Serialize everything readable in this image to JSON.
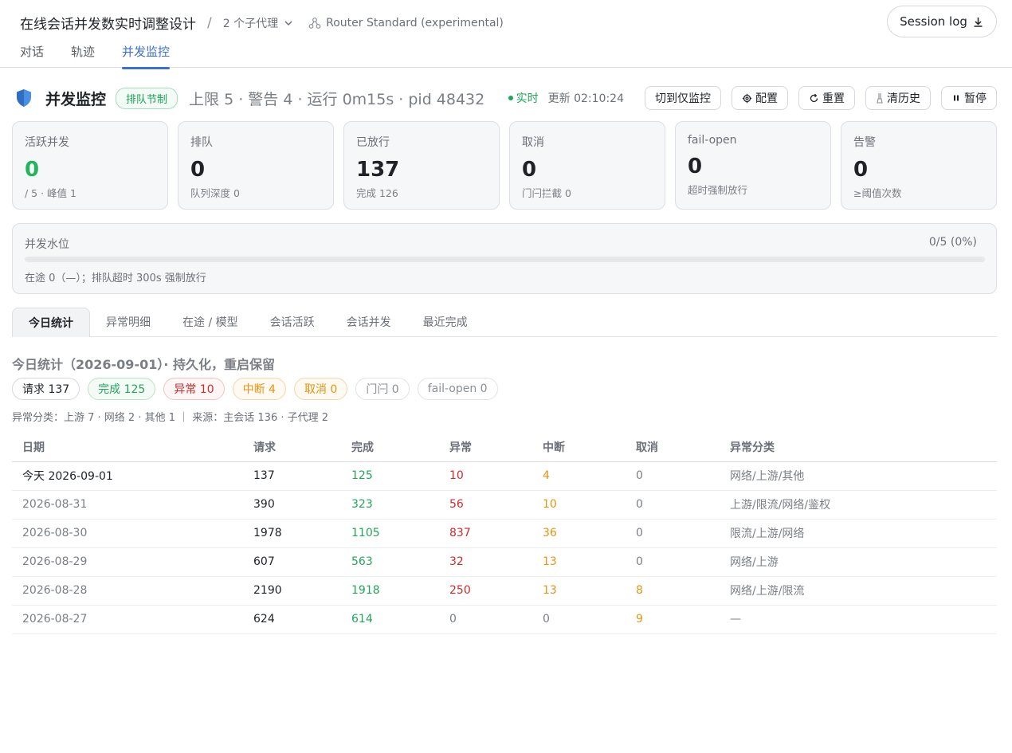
{
  "header": {
    "title": "在线会话并发数实时调整设计",
    "separator": "/",
    "agents_label": "2 个子代理",
    "router_label": "Router Standard (experimental)",
    "session_log_label": "Session log"
  },
  "nav_tabs": [
    {
      "label": "对话",
      "active": false
    },
    {
      "label": "轨迹",
      "active": false
    },
    {
      "label": "并发监控",
      "active": true
    }
  ],
  "monitor": {
    "title": "并发监控",
    "badge": "排队节制",
    "stats_text": "上限 5 · 警告 4 · 运行 0m15s · pid 48432",
    "live_label": "实时",
    "updated_text": "更新 02:10:24",
    "buttons": {
      "monitor_only": "切到仅监控",
      "config": "配置",
      "reset": "重置",
      "clear_history": "清历史",
      "pause": "暂停"
    }
  },
  "cards": [
    {
      "label": "活跃并发",
      "value": "0",
      "sub": "/ 5 · 峰值 1",
      "accent": "green"
    },
    {
      "label": "排队",
      "value": "0",
      "sub": "队列深度 0",
      "accent": ""
    },
    {
      "label": "已放行",
      "value": "137",
      "sub": "完成 126",
      "accent": ""
    },
    {
      "label": "取消",
      "value": "0",
      "sub": "门闩拦截 0",
      "accent": ""
    },
    {
      "label": "fail-open",
      "value": "0",
      "sub": "超时强制放行",
      "accent": ""
    },
    {
      "label": "告警",
      "value": "0",
      "sub": "≥阈值次数",
      "accent": ""
    }
  ],
  "water_level": {
    "label": "并发水位",
    "ratio_text": "0/5  (0%)",
    "fill_fraction": 0,
    "note": "在途 0（—）；排队超时 300s 强制放行"
  },
  "sub_tabs": [
    {
      "label": "今日统计",
      "active": true
    },
    {
      "label": "异常明细",
      "active": false
    },
    {
      "label": "在途 / 模型",
      "active": false
    },
    {
      "label": "会话活跃",
      "active": false
    },
    {
      "label": "会话并发",
      "active": false
    },
    {
      "label": "最近完成",
      "active": false
    }
  ],
  "section": {
    "title": "今日统计（2026-09-01）· 持久化，重启保留",
    "chips": {
      "requests": "请求 137",
      "completed": "完成 125",
      "errors": "异常 10",
      "interrupted": "中断 4",
      "cancelled": "取消 0",
      "latch": "门闩 0",
      "failopen": "fail-open 0"
    },
    "breakdown": "异常分类：上游 7 · 网络 2 · 其他 1 ｜ 来源：主会话 136 · 子代理 2"
  },
  "table": {
    "headers": {
      "date": "日期",
      "requests": "请求",
      "completed": "完成",
      "errors": "异常",
      "interrupted": "中断",
      "cancelled": "取消",
      "categories": "异常分类"
    },
    "rows": [
      {
        "date": "今天 2026-09-01",
        "requests": "137",
        "completed": "125",
        "errors": "10",
        "interrupted": "4",
        "cancelled": "0",
        "categories": "网络/上游/其他",
        "today": true
      },
      {
        "date": "2026-08-31",
        "requests": "390",
        "completed": "323",
        "errors": "56",
        "interrupted": "10",
        "cancelled": "0",
        "categories": "上游/限流/网络/鉴权",
        "today": false
      },
      {
        "date": "2026-08-30",
        "requests": "1978",
        "completed": "1105",
        "errors": "837",
        "interrupted": "36",
        "cancelled": "0",
        "categories": "限流/上游/网络",
        "today": false
      },
      {
        "date": "2026-08-29",
        "requests": "607",
        "completed": "563",
        "errors": "32",
        "interrupted": "13",
        "cancelled": "0",
        "categories": "网络/上游",
        "today": false
      },
      {
        "date": "2026-08-28",
        "requests": "2190",
        "completed": "1918",
        "errors": "250",
        "interrupted": "13",
        "cancelled": "8",
        "categories": "网络/上游/限流",
        "today": false
      },
      {
        "date": "2026-08-27",
        "requests": "624",
        "completed": "614",
        "errors": "0",
        "interrupted": "0",
        "cancelled": "9",
        "categories": "—",
        "today": false
      }
    ]
  },
  "colors": {
    "accent_blue": "#3b6fd4",
    "green": "#22a55b",
    "red": "#cf2b2b",
    "orange": "#e59413"
  }
}
